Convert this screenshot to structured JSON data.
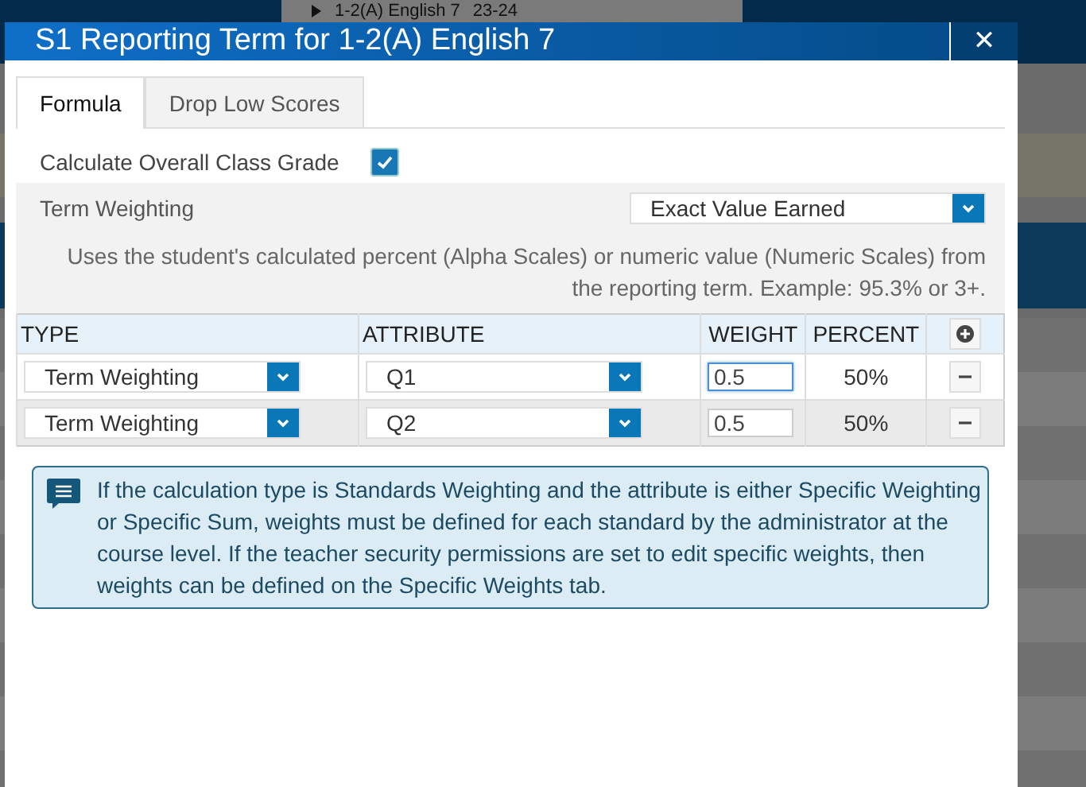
{
  "background": {
    "header_text": "1-2(A) English 7",
    "term": "23-24"
  },
  "dialog": {
    "title": "S1 Reporting Term for 1-2(A) English 7",
    "close": "✕"
  },
  "tabs": [
    {
      "label": "Formula",
      "selected": true
    },
    {
      "label": "Drop Low Scores",
      "selected": false
    }
  ],
  "calculate": {
    "label": "Calculate Overall Class Grade",
    "checked": true
  },
  "term_weighting": {
    "label": "Term Weighting",
    "value": "Exact Value Earned",
    "description": "Uses the student's calculated percent (Alpha Scales) or numeric value (Numeric Scales) from the reporting term. Example: 95.3% or 3+."
  },
  "table": {
    "columns": [
      "TYPE",
      "ATTRIBUTE",
      "WEIGHT",
      "PERCENT"
    ],
    "rows": [
      {
        "type": "Term Weighting",
        "attribute": "Q1",
        "weight": "0.5",
        "percent": "50%",
        "focused": true
      },
      {
        "type": "Term Weighting",
        "attribute": "Q2",
        "weight": "0.5",
        "percent": "50%",
        "focused": false
      }
    ]
  },
  "info": "If the calculation type is Standards Weighting and the attribute is either Specific Weighting or Specific Sum, weights must be defined for each standard by the administrator at the course level. If the teacher security permissions are set to edit specific weights, then weights can be defined on the Specific Weights tab."
}
